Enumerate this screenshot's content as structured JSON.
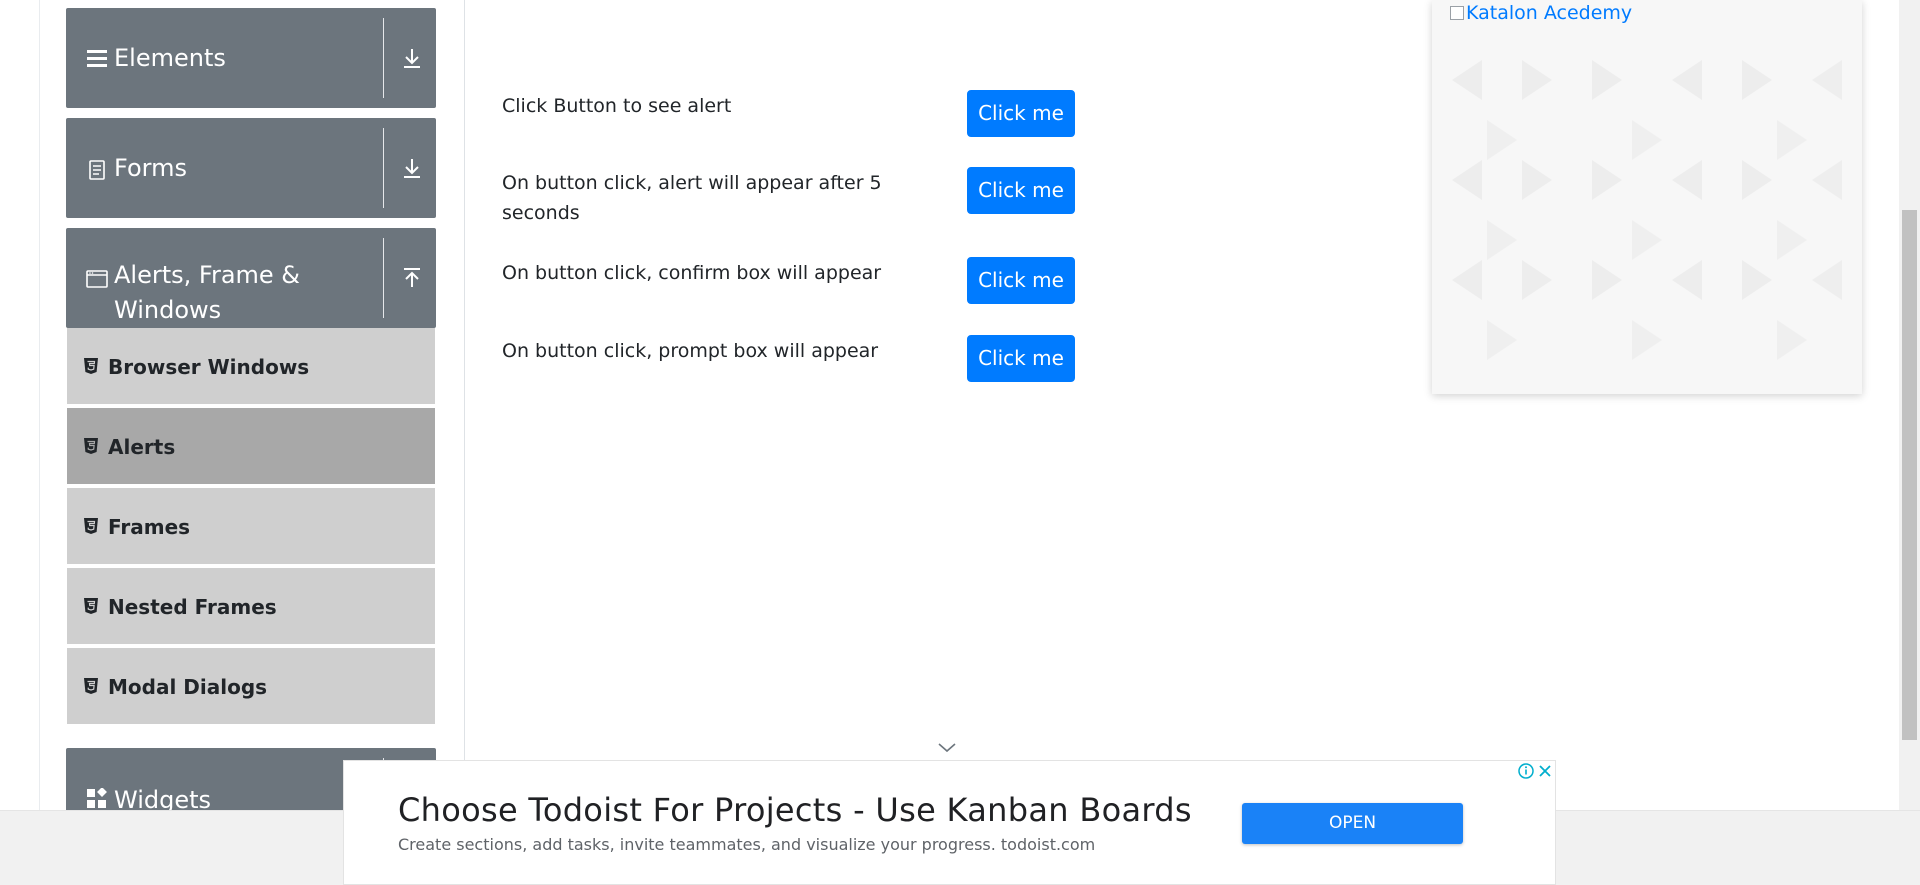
{
  "sidebar": {
    "groups": [
      {
        "title": "Elements",
        "icon": "menu-lines-icon",
        "toggle_icon": "download-arrow-icon"
      },
      {
        "title": "Forms",
        "icon": "document-icon",
        "toggle_icon": "download-arrow-icon"
      },
      {
        "title_line1": "Alerts, Frame &",
        "title_line2": "Windows",
        "icon": "window-icon",
        "toggle_icon": "upload-arrow-icon"
      },
      {
        "title": "Widgets",
        "icon": "widgets-icon"
      }
    ],
    "items": [
      {
        "label": "Browser Windows",
        "icon": "html5-icon",
        "active": false
      },
      {
        "label": "Alerts",
        "icon": "html5-icon",
        "active": true
      },
      {
        "label": "Frames",
        "icon": "html5-icon",
        "active": false
      },
      {
        "label": "Nested Frames",
        "icon": "html5-icon",
        "active": false
      },
      {
        "label": "Modal Dialogs",
        "icon": "html5-icon",
        "active": false
      }
    ]
  },
  "main": {
    "rows": [
      {
        "text": "Click Button to see alert",
        "button": "Click me"
      },
      {
        "text_line1": "On button click, alert will appear after 5",
        "text_line2": "seconds",
        "button": "Click me"
      },
      {
        "text": "On button click, confirm box will appear",
        "button": "Click me"
      },
      {
        "text": "On button click, prompt box will appear",
        "button": "Click me"
      }
    ]
  },
  "side_ad": {
    "alt_text": "Katalon Acedemy"
  },
  "banner_ad": {
    "title": "Choose Todoist For Projects - Use Kanban Boards",
    "subtitle": "Create sections, add tasks, invite teammates, and visualize your progress. todoist.com",
    "button": "OPEN"
  },
  "colors": {
    "primary": "#007bff",
    "sidebar_header": "#6c757d",
    "sidebar_item": "#cfcfcf",
    "sidebar_item_active": "#a8a8a8"
  }
}
